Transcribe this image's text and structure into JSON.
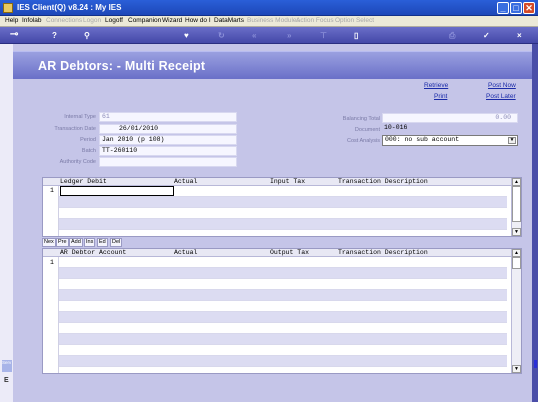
{
  "window": {
    "title": "IES Client(Q) v8.24 : My IES",
    "min": "_",
    "max": "□",
    "close": "✕"
  },
  "menu": [
    {
      "label": "Help",
      "disabled": false
    },
    {
      "label": "Infolab",
      "disabled": false
    },
    {
      "label": "Connections",
      "disabled": true
    },
    {
      "label": "Logon",
      "disabled": true
    },
    {
      "label": "Logoff",
      "disabled": false
    },
    {
      "label": "Companion",
      "disabled": false
    },
    {
      "label": "Wizard",
      "disabled": false
    },
    {
      "label": "How do I",
      "disabled": false
    },
    {
      "label": "DataMarts",
      "disabled": false
    },
    {
      "label": "Business Modules",
      "disabled": true
    },
    {
      "label": "Action Focus",
      "disabled": true
    },
    {
      "label": "Option Select",
      "disabled": true
    }
  ],
  "toolbar": {
    "icons": [
      {
        "name": "key-icon",
        "glyph": "⊸"
      },
      {
        "name": "help-icon",
        "glyph": "?"
      },
      {
        "name": "search-icon",
        "glyph": "⚲"
      },
      {
        "name": "heart-icon",
        "glyph": "♥"
      },
      {
        "name": "refresh-icon",
        "glyph": "↻"
      },
      {
        "name": "back-icon",
        "glyph": "«"
      },
      {
        "name": "forward-icon",
        "glyph": "»"
      },
      {
        "name": "tree-icon",
        "glyph": "⊤"
      },
      {
        "name": "page-icon",
        "glyph": "▯"
      },
      {
        "name": "print-icon",
        "glyph": "⎙"
      },
      {
        "name": "check-icon",
        "glyph": "✓"
      },
      {
        "name": "close-icon",
        "glyph": "×"
      }
    ]
  },
  "page": {
    "title": "AR Debtors: - Multi Receipt",
    "links": {
      "retrieve": "Retrieve",
      "print": "Print",
      "post_now": "Post Now",
      "post_later": "Post Later"
    }
  },
  "fields": {
    "internal_type": {
      "label": "Internal Type",
      "value": "61"
    },
    "transaction_date": {
      "label": "Transaction Date",
      "value": "26/01/2010"
    },
    "period": {
      "label": "Period",
      "value": "Jan 2010 (p 108)"
    },
    "batch": {
      "label": "Batch",
      "value": "TT-260110"
    },
    "authority_code": {
      "label": "Authority Code",
      "value": ""
    },
    "balancing_total": {
      "label": "Balancing Total",
      "value": "0.00"
    },
    "document": {
      "label": "Document",
      "value": "10-016"
    },
    "cost_analysis": {
      "label": "Cost Analysis",
      "value": "000: no sub account"
    }
  },
  "grid1": {
    "columns": [
      "Ledger Debit",
      "Actual",
      "Input Tax",
      "Transaction Description"
    ],
    "row_num": "1"
  },
  "row_buttons": [
    "Nex",
    "Pre",
    "Add",
    "Ins",
    "Ed",
    "Del"
  ],
  "grid2": {
    "columns": [
      "AR Debtor Account",
      "Actual",
      "Output Tax",
      "Transaction Description"
    ],
    "row_num": "1"
  },
  "sidebar": {
    "label": "Serv",
    "mark": "E"
  }
}
